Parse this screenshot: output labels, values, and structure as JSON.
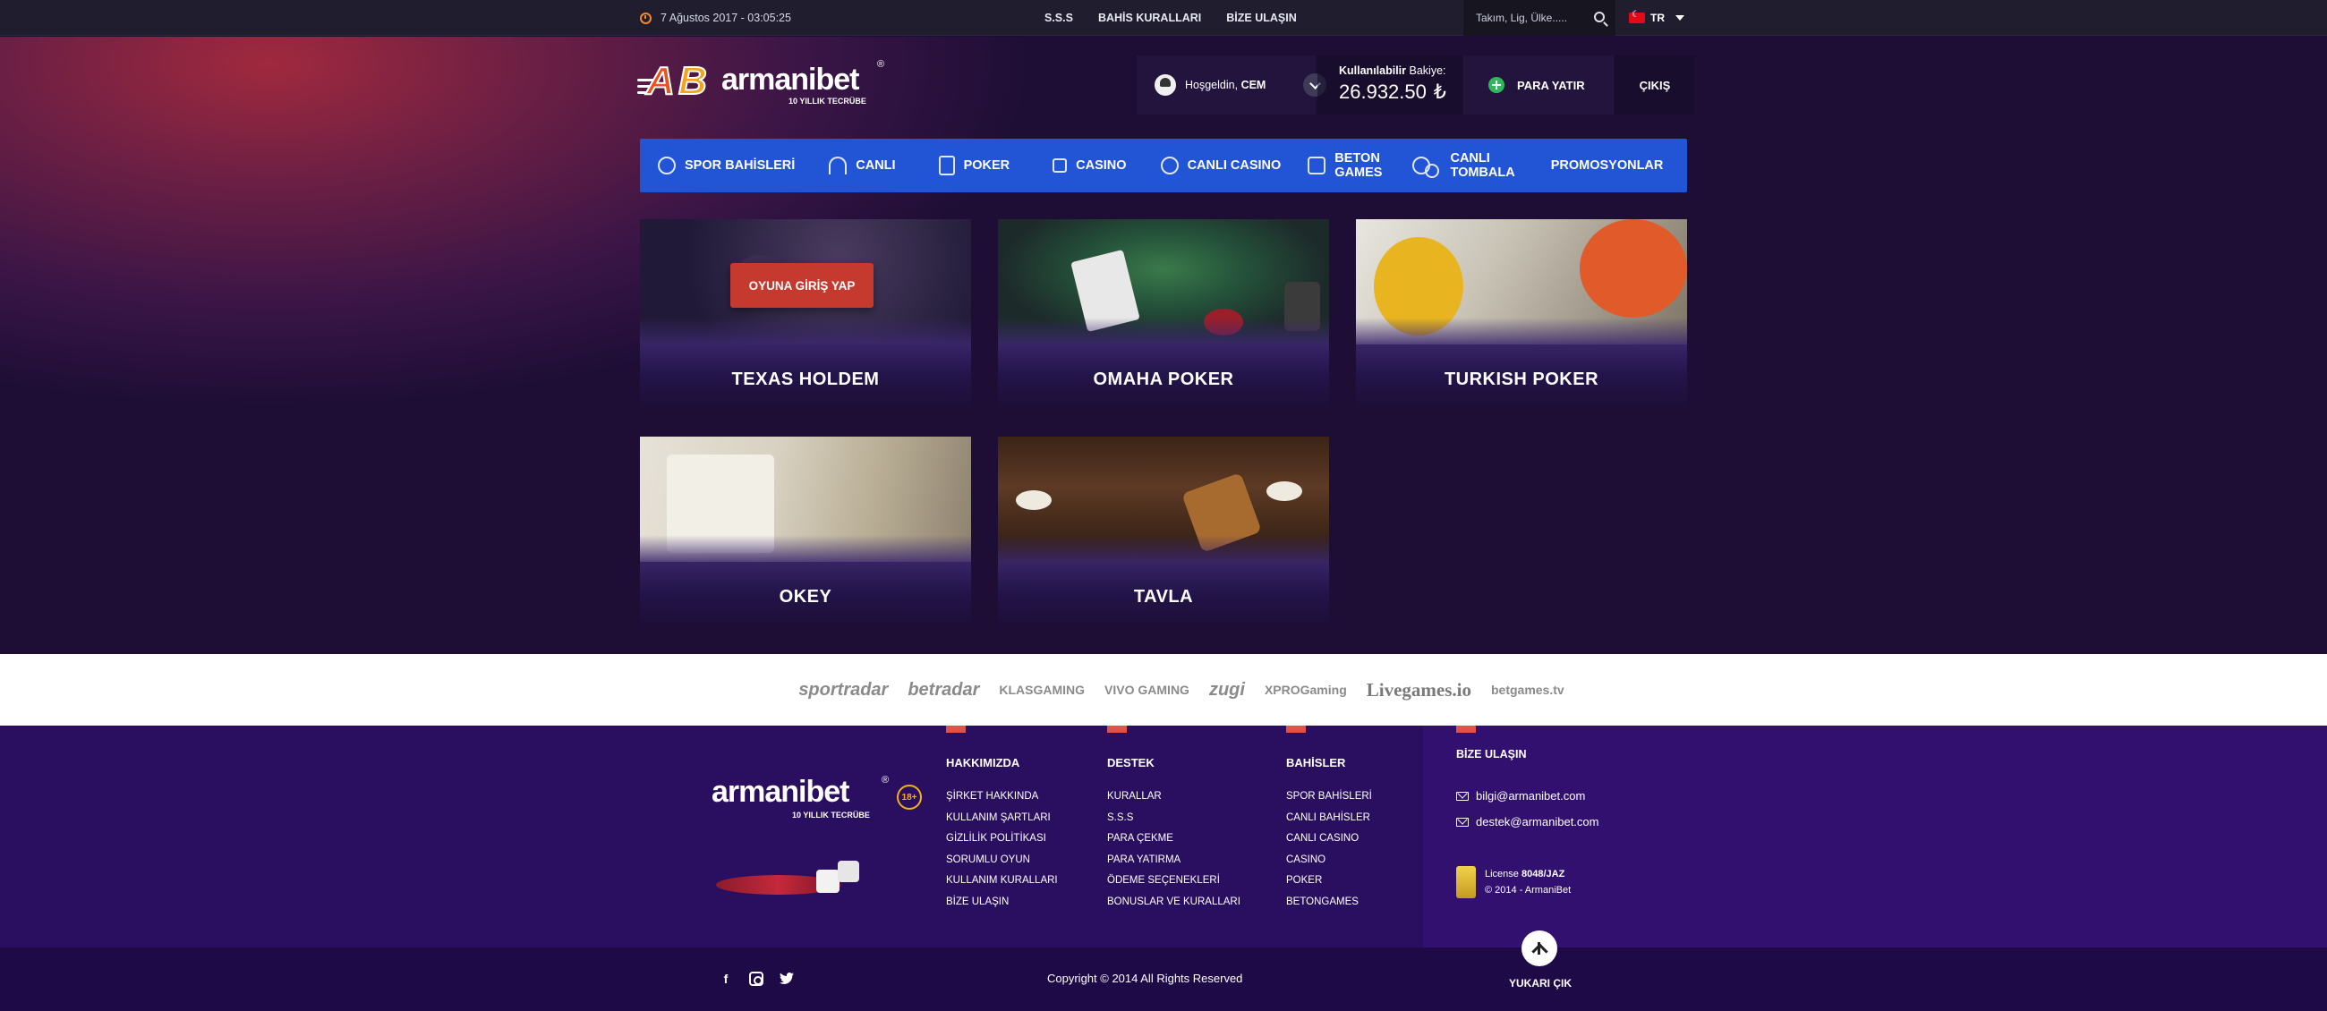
{
  "topbar": {
    "datetime": "7 Ağustos 2017 - 03:05:25",
    "links": [
      "S.S.S",
      "BAHİS KURALLARI",
      "BİZE ULAŞIN"
    ],
    "search_placeholder": "Takım, Lig, Ülke.....",
    "language": "TR"
  },
  "brand": {
    "logo_letters": "AB",
    "name": "armanibet",
    "tagline": "10 YILLIK TECRÜBE",
    "reg": "®"
  },
  "user": {
    "greeting": "Hoşgeldin,",
    "name": "CEM",
    "balance_label_bold": "Kullanılabilir",
    "balance_label": "Bakiye:",
    "balance": "26.932.50",
    "currency": "₺",
    "deposit_label": "PARA YATIR",
    "logout_label": "ÇIKIŞ"
  },
  "nav": [
    {
      "label": "SPOR BAHİSLERİ",
      "icon": "soccer-ball-icon"
    },
    {
      "label": "CANLI",
      "icon": "live-signal-icon"
    },
    {
      "label": "POKER",
      "icon": "poker-cards-icon"
    },
    {
      "label": "CASINO",
      "icon": "casino-icon"
    },
    {
      "label": "CANLI CASINO",
      "icon": "roulette-icon"
    },
    {
      "label_line1": "BETON",
      "label_line2": "GAMES",
      "icon": "betongames-icon"
    },
    {
      "label_line1": "CANLI",
      "label_line2": "TOMBALA",
      "icon": "tombala-balls-icon"
    },
    {
      "label": "PROMOSYONLAR"
    }
  ],
  "games": [
    {
      "title": "TEXAS HOLDEM",
      "cta": "OYUNA GİRİŞ YAP"
    },
    {
      "title": "OMAHA POKER"
    },
    {
      "title": "TURKISH POKER"
    },
    {
      "title": "OKEY"
    },
    {
      "title": "TAVLA"
    }
  ],
  "partners": [
    "sportradar",
    "betradar",
    "KLASGAMING",
    "VIVO GAMING",
    "zugi",
    "XPROGaming",
    "Livegames.io",
    "betgames.tv"
  ],
  "footer": {
    "age_badge": "18+",
    "columns": [
      {
        "title": "HAKKIMIZDA",
        "items": [
          "ŞİRKET HAKKINDA",
          "KULLANIM ŞARTLARI",
          "GİZLİLİK POLİTİKASI",
          "SORUMLU OYUN",
          "KULLANIM KURALLARI",
          "BİZE ULAŞIN"
        ]
      },
      {
        "title": "DESTEK",
        "items": [
          "KURALLAR",
          "S.S.S",
          "PARA ÇEKME",
          "PARA YATIRMA",
          "ÖDEME SEÇENEKLERİ",
          "BONUSLAR VE KURALLARI"
        ]
      },
      {
        "title": "BAHİSLER",
        "items": [
          "SPOR BAHİSLERİ",
          "CANLI BAHİSLER",
          "CANLI CASINO",
          "CASINO",
          "POKER",
          "BETONGAMES"
        ]
      }
    ],
    "contact": {
      "title": "BİZE ULAŞIN",
      "emails": [
        "bilgi@armanibet.com",
        "destek@armanibet.com"
      ]
    },
    "license_prefix": "License",
    "license_no": "8048/JAZ",
    "license_copy": "© 2014 - ArmaniBet",
    "copyright": "Copyright © 2014 All Rights Reserved",
    "to_top": "YUKARI ÇIK"
  },
  "colors": {
    "nav_blue": "#2254d6",
    "cta_red": "#c6392f",
    "footer_purple": "#2a0f60",
    "accent_orange": "#f08a2a",
    "deposit_green": "#2fb75c"
  }
}
